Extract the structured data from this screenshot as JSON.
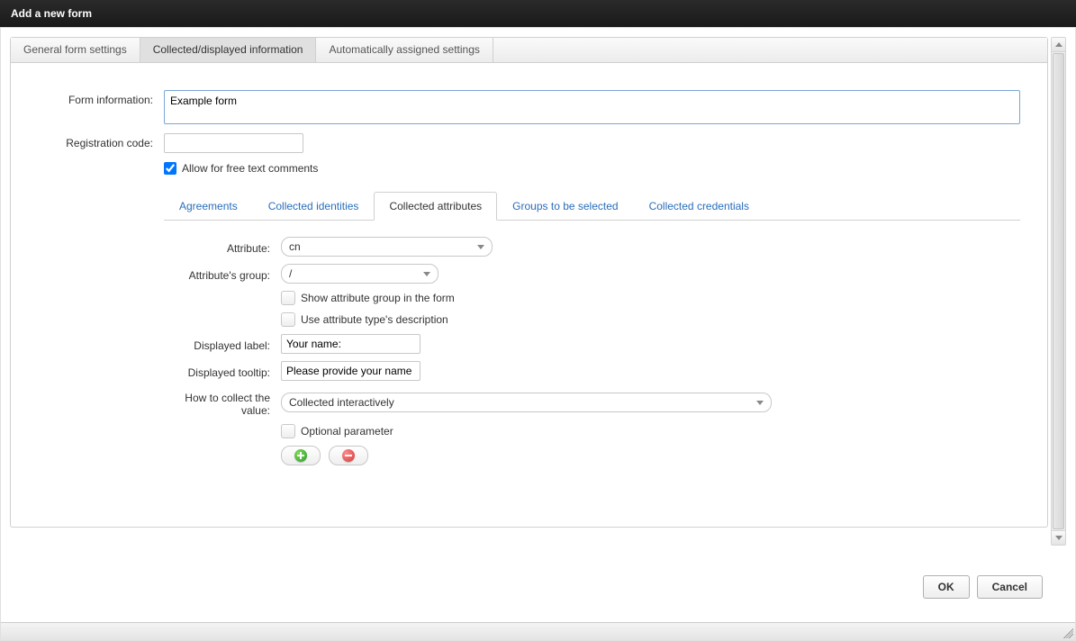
{
  "title": "Add a new form",
  "mainTabs": {
    "tab0": "General form settings",
    "tab1": "Collected/displayed information",
    "tab2": "Automatically assigned settings"
  },
  "labels": {
    "formInfo": "Form information:",
    "regCode": "Registration code:",
    "freeText": "Allow for free text comments",
    "attribute": "Attribute:",
    "attributeGroup": "Attribute's group:",
    "showGroup": "Show attribute group in the form",
    "useDesc": "Use attribute type's description",
    "displayedLabel": "Displayed label:",
    "displayedTooltip": "Displayed tooltip:",
    "howCollect": "How to collect the value:",
    "optional": "Optional parameter"
  },
  "values": {
    "formInfo": "Example form",
    "regCode": "",
    "attribute": "cn",
    "attributeGroup": "/",
    "displayedLabel": "Your name:",
    "displayedTooltip": "Please provide your name",
    "howCollect": "Collected interactively"
  },
  "subTabs": {
    "t0": "Agreements",
    "t1": "Collected identities",
    "t2": "Collected attributes",
    "t3": "Groups to be selected",
    "t4": "Collected credentials"
  },
  "buttons": {
    "ok": "OK",
    "cancel": "Cancel"
  }
}
